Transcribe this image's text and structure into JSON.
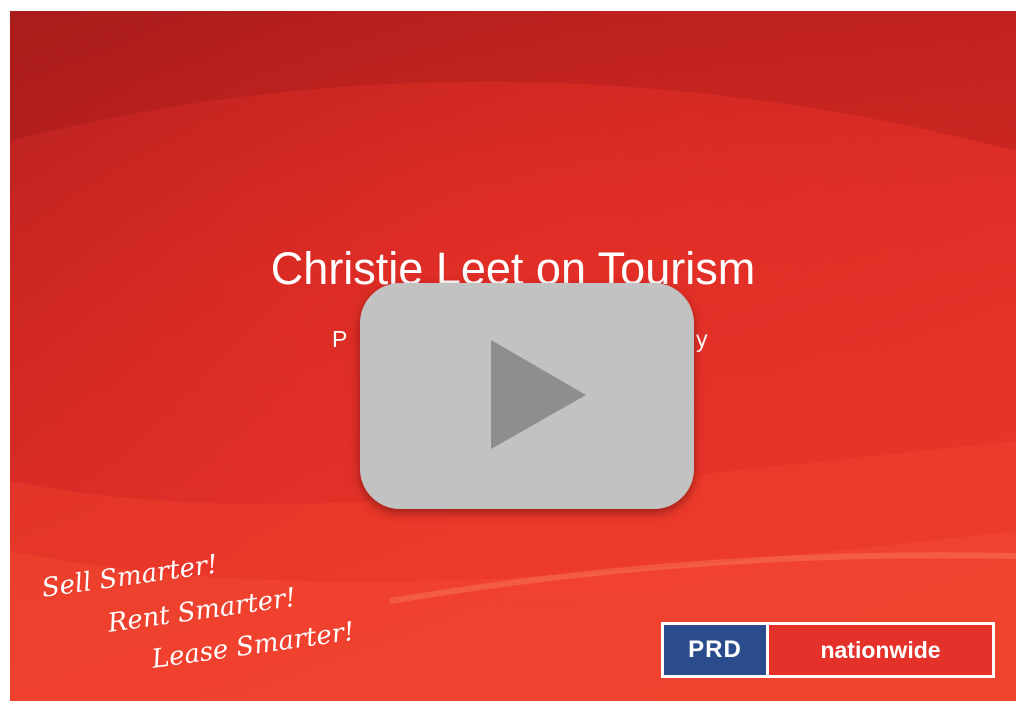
{
  "slide": {
    "title": "Christie Leet on Tourism",
    "subtitle_left": "P",
    "subtitle_right": "y"
  },
  "player": {
    "play_button_icon": "play-icon"
  },
  "tagline": {
    "line1": "Sell Smarter!",
    "line2": "Rent Smarter!",
    "line3": "Lease Smarter!"
  },
  "logo": {
    "part1": "PRD",
    "part2": "nationwide",
    "colors": {
      "prd_bg": "#2a4c8c",
      "nationwide_bg": "#e4312a"
    }
  },
  "colors": {
    "slide_red": "#d22823",
    "play_button": "#c2c2c2",
    "play_triangle": "#8e8e8e"
  }
}
